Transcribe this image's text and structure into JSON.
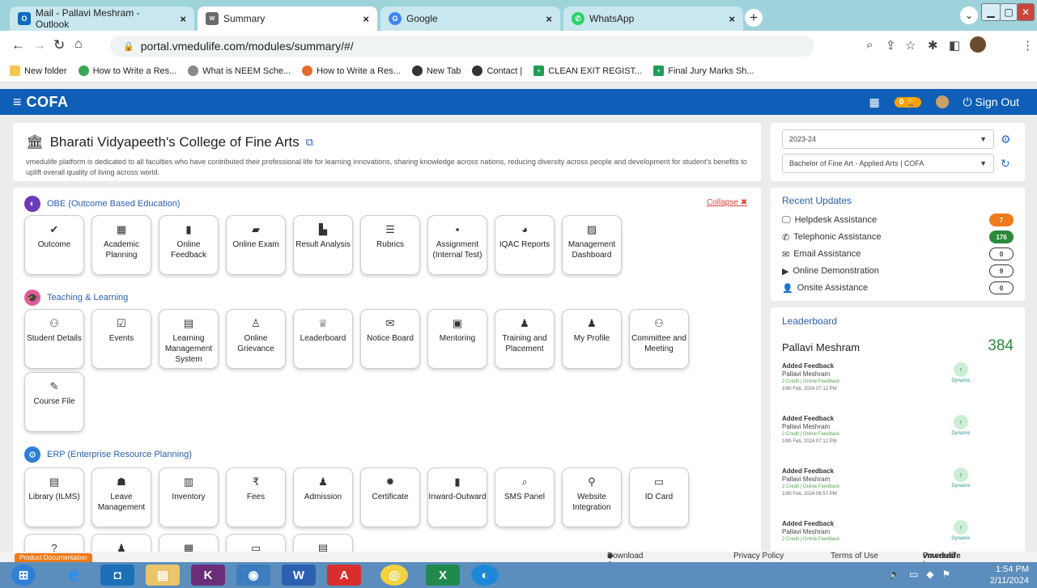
{
  "browser": {
    "tabs": [
      {
        "title": "Mail - Pallavi Meshram - Outlook",
        "icon": "outlook-icon",
        "color": "#0f6cbd"
      },
      {
        "title": "Summary",
        "icon": "vmedulife-icon",
        "color": "#6b6b6b"
      },
      {
        "title": "Google",
        "icon": "google-icon",
        "color": "#4285f4"
      },
      {
        "title": "WhatsApp",
        "icon": "whatsapp-icon",
        "color": "#25d366"
      }
    ],
    "url": "portal.vmedulife.com/modules/summary/#/",
    "bookmarks": [
      {
        "label": "New folder",
        "color": "#f2c94c"
      },
      {
        "label": "How to Write a Res...",
        "color": "#3aa655"
      },
      {
        "label": "What is NEEM Sche...",
        "color": "#888888"
      },
      {
        "label": "How to Write a Res...",
        "color": "#e8682a"
      },
      {
        "label": "New Tab",
        "color": "#333333"
      },
      {
        "label": "Contact |",
        "color": "#333333"
      },
      {
        "label": "CLEAN EXIT REGIST...",
        "color": "#1f9d55"
      },
      {
        "label": "Final Jury Marks Sh...",
        "color": "#1f9d55"
      }
    ]
  },
  "app": {
    "brand": "COFA",
    "signout": "Sign Out",
    "badge_count": "0",
    "accent": "#0f5eb8"
  },
  "college": {
    "name": "Bharati Vidyapeeth's College of Fine Arts",
    "description": "vmedulife platform is dedicated to all faculties who have contributed their professional life for learning innovations, sharing knowledge across nations, reducing diversity across people and development for student's benefits to uplift overall quality of living across world."
  },
  "selectors": {
    "year": "2023-24",
    "program": "Bachelor of Fine Art - Applied Arts | COFA"
  },
  "sections": {
    "obe": {
      "title": "OBE (Outcome Based Education)",
      "collapse": "Collapse"
    },
    "teaching": {
      "title": "Teaching & Learning"
    },
    "erp": {
      "title": "ERP (Enterprise Resource Planning)"
    }
  },
  "obe_tiles": [
    "Outcome",
    "Academic Planning",
    "Online Feedback",
    "Online Exam",
    "Result Analysis",
    "Rubrics",
    "Assignment (Internal Test)",
    "IQAC Reports",
    "Management Dashboard"
  ],
  "teaching_tiles": [
    "Student Details",
    "Events",
    "Learning Management System",
    "Online Grievance",
    "Leaderboard",
    "Notice Board",
    "Mentoring",
    "Training and Placement",
    "My Profile",
    "Committee and Meeting",
    "Course File"
  ],
  "erp_tiles": [
    "Library (ILMS)",
    "Leave Management",
    "Inventory",
    "Fees",
    "Admission",
    "Certificate",
    "Inward-Outward",
    "SMS Panel",
    "Website Integration",
    "ID Card"
  ],
  "updates": {
    "title": "Recent Updates",
    "items": [
      {
        "label": "Helpdesk Assistance",
        "count": "7",
        "color": "#f07a1a"
      },
      {
        "label": "Telephonic Assistance",
        "count": "176",
        "color": "#2a8a3a"
      },
      {
        "label": "Email Assistance",
        "count": "0",
        "color": "#ffffff"
      },
      {
        "label": "Online Demonstration",
        "count": "9",
        "color": "#ffffff"
      },
      {
        "label": "Onsite Assistance",
        "count": "0",
        "color": "#ffffff"
      }
    ]
  },
  "leaderboard": {
    "title": "Leaderboard",
    "name": "Pallavi Meshram",
    "score": "384",
    "feed": [
      {
        "action": "Added Feedback",
        "user": "Pallavi Meshram",
        "credit": "2 Credit | Online Feedback",
        "time": "10th Feb, 2024 07:12 PM",
        "tag": "Dynamic"
      },
      {
        "action": "Added Feedback",
        "user": "Pallavi Meshram",
        "credit": "2 Credit | Online Feedback",
        "time": "10th Feb, 2024 07:12 PM",
        "tag": "Dynamic"
      },
      {
        "action": "Added Feedback",
        "user": "Pallavi Meshram",
        "credit": "2 Credit | Online Feedback",
        "time": "10th Feb, 2024 06:57 PM",
        "tag": "Dynamic"
      },
      {
        "action": "Added Feedback",
        "user": "Pallavi Meshram",
        "credit": "2 Credit | Online Feedback",
        "time": "",
        "tag": "Dynamic"
      }
    ]
  },
  "footer": {
    "product_doc": "Product Documentation",
    "download": "Download App",
    "privacy": "Privacy Policy",
    "terms": "Terms of Use",
    "powered": "Powered by",
    "powered_brand": "vmedulife"
  },
  "taskbar": {
    "time": "1:54 PM",
    "date": "2/11/2024"
  }
}
